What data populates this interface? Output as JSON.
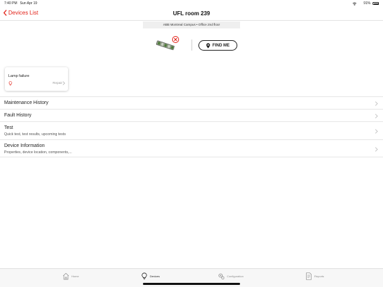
{
  "status": {
    "time": "7:40 PM",
    "date": "Sun Apr 19",
    "battery": "91%"
  },
  "nav": {
    "back_label": "Devices List",
    "title": "UFL room 239"
  },
  "location": "ABB Montreal Campus • Office 2nd floor",
  "find_me_label": "FIND ME",
  "fault": {
    "title": "Lamp failure",
    "action": "Repair"
  },
  "menu": [
    {
      "title": "Maintenance History",
      "subtitle": ""
    },
    {
      "title": "Fault History",
      "subtitle": ""
    },
    {
      "title": "Test",
      "subtitle": "Quick test, test results, upcoming tests"
    },
    {
      "title": "Device Information",
      "subtitle": "Properties, device location, components,..."
    }
  ],
  "tabs": [
    {
      "label": "Home",
      "icon": "home-icon"
    },
    {
      "label": "Devices",
      "icon": "lightbulb-icon",
      "active": true
    },
    {
      "label": "Configuration",
      "icon": "gears-icon"
    },
    {
      "label": "Reports",
      "icon": "document-icon"
    }
  ],
  "colors": {
    "accent": "#e2231a",
    "text": "#1f1f1f",
    "divider": "#e6e6e6"
  }
}
